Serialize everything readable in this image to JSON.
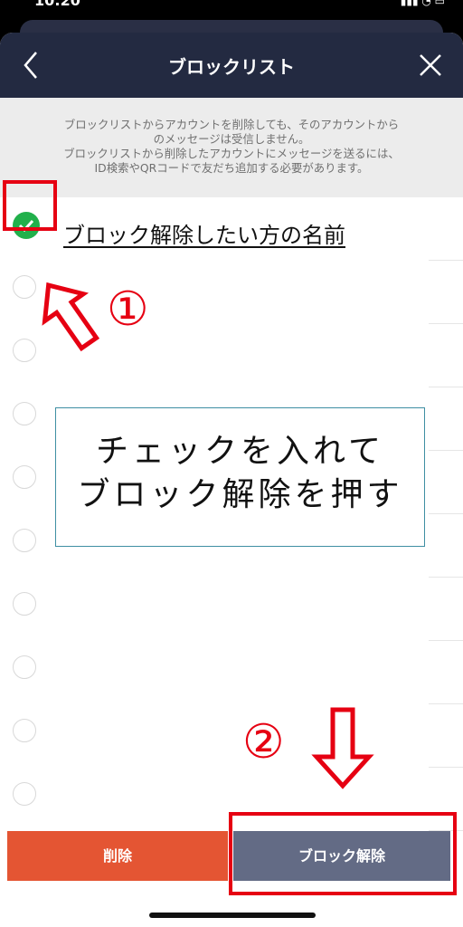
{
  "status_bar": {
    "time": "10:20",
    "icons": "▮▮▮ ◔ ▭"
  },
  "header": {
    "title": "ブロックリスト",
    "back_icon": "back-chevron-icon",
    "close_icon": "close-icon",
    "background_color": "#232a41"
  },
  "info": {
    "lines": [
      "ブロックリストからアカウントを削除しても、そのアカウントから",
      "のメッセージは受信しません。",
      "ブロックリストから削除したアカウントにメッセージを送るには、",
      "ID検索やQRコードで友だち追加する必要があります。"
    ]
  },
  "list": {
    "first_item": {
      "name": "ブロック解除したい方の名前",
      "checked": true
    }
  },
  "annotations": {
    "step1": "①",
    "step2": "②",
    "callout_lines": [
      "チェックを入れて",
      "ブロック解除を押す"
    ],
    "highlight_color": "#e60012"
  },
  "buttons": {
    "delete_label": "削除",
    "unblock_label": "ブロック解除",
    "delete_color": "#e45533",
    "unblock_color": "#636b85"
  }
}
